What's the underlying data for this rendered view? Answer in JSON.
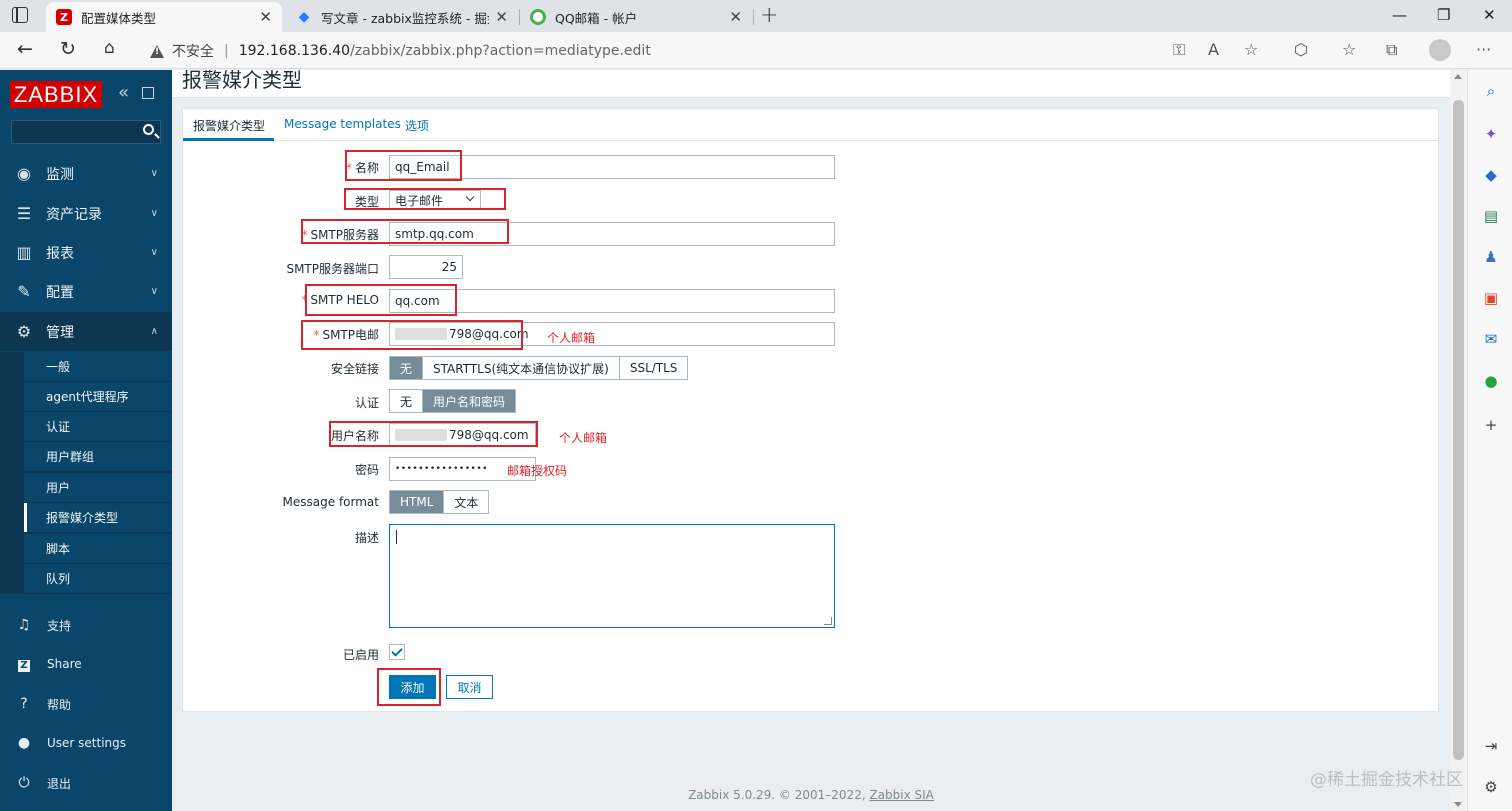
{
  "browser": {
    "tabs": [
      {
        "title": "配置媒体类型",
        "favicon": "Z",
        "favicon_color": "#d40000",
        "active": true
      },
      {
        "title": "写文章 - zabbix监控系统 - 掘金",
        "favicon": "juejin-icon",
        "favicon_color": "#1e80ff",
        "active": false
      },
      {
        "title": "QQ邮箱 - 帐户",
        "favicon": "qq-mail-icon",
        "favicon_color": "#f5a623",
        "active": false
      }
    ],
    "address": {
      "insecure_label": "不安全",
      "url_host": "192.168.136.40",
      "url_path": "/zabbix/zabbix.php?action=mediatype.edit"
    }
  },
  "sidebar": {
    "logo": "ZABBIX",
    "menu": [
      {
        "label": "监测",
        "icon": "eye-icon"
      },
      {
        "label": "资产记录",
        "icon": "list-icon"
      },
      {
        "label": "报表",
        "icon": "chart-icon"
      },
      {
        "label": "配置",
        "icon": "wrench-icon"
      },
      {
        "label": "管理",
        "icon": "gear-icon"
      }
    ],
    "admin_submenu": [
      "一般",
      "agent代理程序",
      "认证",
      "用户群组",
      "用户",
      "报警媒介类型",
      "脚本",
      "队列"
    ],
    "selected_submenu": "报警媒介类型",
    "bottom": [
      {
        "label": "支持",
        "icon": "headset-icon"
      },
      {
        "label": "Share",
        "icon": "share-icon"
      },
      {
        "label": "帮助",
        "icon": "help-icon"
      },
      {
        "label": "User settings",
        "icon": "user-icon"
      },
      {
        "label": "退出",
        "icon": "power-icon"
      }
    ]
  },
  "page": {
    "title": "报警媒介类型",
    "tabs": [
      "报警媒介类型",
      "Message templates",
      "选项"
    ],
    "form": {
      "name_label": "名称",
      "name_value": "qq_Email",
      "type_label": "类型",
      "type_value": "电子邮件",
      "smtp_server_label": "SMTP服务器",
      "smtp_server_value": "smtp.qq.com",
      "smtp_port_label": "SMTP服务器端口",
      "smtp_port_value": "25",
      "smtp_helo_label": "SMTP HELO",
      "smtp_helo_value": "qq.com",
      "smtp_email_label": "SMTP电邮",
      "smtp_email_value": "798@qq.com",
      "security_label": "安全链接",
      "security_options": [
        "无",
        "STARTTLS(纯文本通信协议扩展)",
        "SSL/TLS"
      ],
      "security_selected": "无",
      "auth_label": "认证",
      "auth_options": [
        "无",
        "用户名和密码"
      ],
      "auth_selected": "用户名和密码",
      "username_label": "用户名称",
      "username_value": "798@qq.com",
      "password_label": "密码",
      "password_value": "••••••••••••••••",
      "format_label": "Message format",
      "format_options": [
        "HTML",
        "文本"
      ],
      "format_selected": "HTML",
      "description_label": "描述",
      "description_value": "",
      "enabled_label": "已启用",
      "enabled": true,
      "add_button": "添加",
      "cancel_button": "取消"
    },
    "annotations": {
      "smtp_email_note": "个人邮箱",
      "username_note": "个人邮箱",
      "password_note": "邮箱授权码"
    },
    "footer": {
      "text": "Zabbix 5.0.29. © 2001–2022,",
      "link": "Zabbix SIA"
    }
  },
  "watermark": "@稀土掘金技术社区",
  "colors": {
    "sidebar_bg": "#0a466a",
    "logo_red": "#d40000",
    "primary_blue": "#0275b8",
    "annotation_red": "#d9232d",
    "segment_on": "#768d99"
  }
}
